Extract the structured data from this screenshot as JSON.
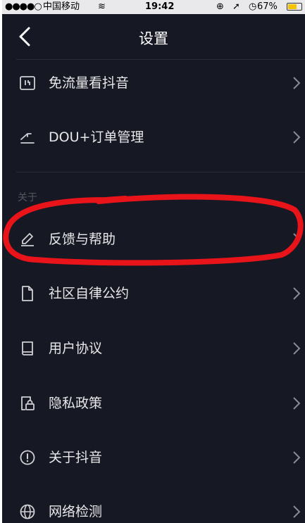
{
  "status_bar": {
    "signal": "●●●●○",
    "carrier": "中国移动",
    "wifi": "≋",
    "time": "19:42",
    "battery_pct": "67%",
    "battery_level": 0.67
  },
  "nav": {
    "title": "设置"
  },
  "rows_top": [
    {
      "label": "免流量看抖音",
      "icon": "data-free-icon"
    },
    {
      "label": "DOU+订单管理",
      "icon": "trend-icon"
    }
  ],
  "section": {
    "header": "关于"
  },
  "rows_main": [
    {
      "label": "反馈与帮助",
      "icon": "pen-icon"
    },
    {
      "label": "社区自律公约",
      "icon": "document-icon"
    },
    {
      "label": "用户协议",
      "icon": "book-icon"
    },
    {
      "label": "隐私政策",
      "icon": "privacy-lock-icon"
    },
    {
      "label": "关于抖音",
      "icon": "info-icon"
    },
    {
      "label": "网络检测",
      "icon": "globe-icon"
    }
  ],
  "colors": {
    "background": "#161823",
    "text": "#e8e8ea",
    "highlight": "#e8141a"
  }
}
